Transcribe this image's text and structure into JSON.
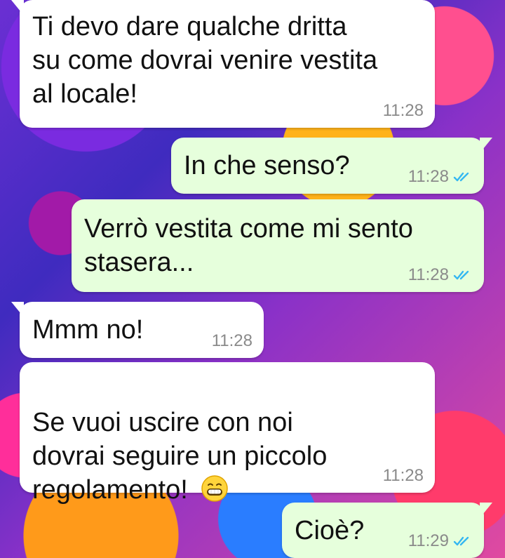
{
  "messages": [
    {
      "direction": "incoming",
      "text": "Ti devo dare qualche dritta\nsu come dovrai venire vestita\nal locale!",
      "time": "11:28"
    },
    {
      "direction": "outgoing",
      "text": "In che senso?",
      "time": "11:28",
      "status_icon": "double-check-icon"
    },
    {
      "direction": "outgoing",
      "text": "Verrò vestita come mi sento\nstasera...",
      "time": "11:28",
      "status_icon": "double-check-icon"
    },
    {
      "direction": "incoming",
      "text": "Mmm no!",
      "time": "11:28"
    },
    {
      "direction": "incoming",
      "text": "Se vuoi uscire con noi\ndovrai seguire un piccolo\nregolamento! ",
      "emoji": "grinning-face-icon",
      "time": "11:28"
    },
    {
      "direction": "outgoing",
      "text": "Cioè?",
      "time": "11:29",
      "status_icon": "double-check-icon"
    }
  ],
  "colors": {
    "incoming_bubble": "#ffffff",
    "outgoing_bubble": "#e6ffdc",
    "timestamp": "#8a8a8a",
    "read_ticks": "#34b7f1"
  }
}
